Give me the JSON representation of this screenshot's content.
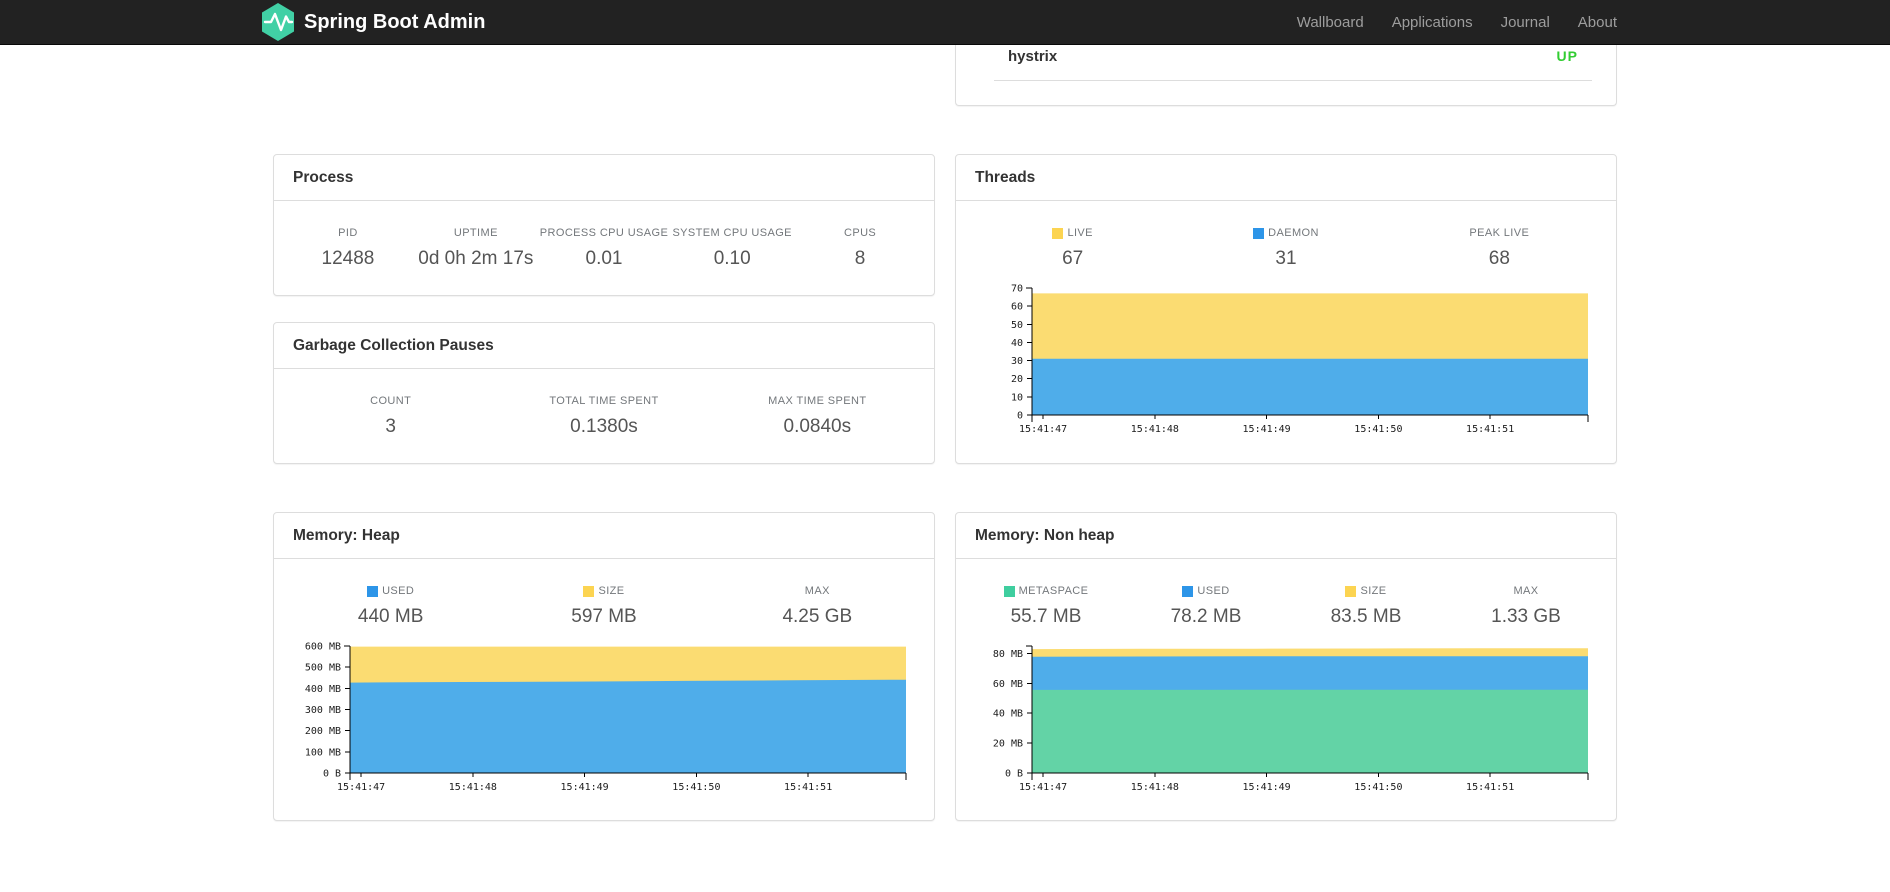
{
  "navbar": {
    "brand": "Spring Boot Admin",
    "logo_color": "#41d0a5",
    "links": [
      {
        "label": "Wallboard"
      },
      {
        "label": "Applications"
      },
      {
        "label": "Journal"
      },
      {
        "label": "About"
      }
    ]
  },
  "application_panel": {
    "name": "hystrix",
    "status": "UP",
    "status_color": "#32cd32"
  },
  "process": {
    "title": "Process",
    "stats": [
      {
        "label": "PID",
        "value": "12488"
      },
      {
        "label": "UPTIME",
        "value": "0d 0h 2m 17s"
      },
      {
        "label": "PROCESS CPU USAGE",
        "value": "0.01"
      },
      {
        "label": "SYSTEM CPU USAGE",
        "value": "0.10"
      },
      {
        "label": "CPUS",
        "value": "8"
      }
    ]
  },
  "gc": {
    "title": "Garbage Collection Pauses",
    "stats": [
      {
        "label": "COUNT",
        "value": "3"
      },
      {
        "label": "TOTAL TIME SPENT",
        "value": "0.1380s"
      },
      {
        "label": "MAX TIME SPENT",
        "value": "0.0840s"
      }
    ]
  },
  "threads": {
    "title": "Threads",
    "stats": [
      {
        "label": "LIVE",
        "value": "67",
        "swatch": "#fcd451"
      },
      {
        "label": "DAEMON",
        "value": "31",
        "swatch": "#2d95e8"
      },
      {
        "label": "PEAK LIVE",
        "value": "68"
      }
    ]
  },
  "heap": {
    "title": "Memory: Heap",
    "stats": [
      {
        "label": "USED",
        "value": "440 MB",
        "swatch": "#2d95e8"
      },
      {
        "label": "SIZE",
        "value": "597 MB",
        "swatch": "#fcd451"
      },
      {
        "label": "MAX",
        "value": "4.25 GB"
      }
    ]
  },
  "nonheap": {
    "title": "Memory: Non heap",
    "stats": [
      {
        "label": "METASPACE",
        "value": "55.7 MB",
        "swatch": "#3fce9f"
      },
      {
        "label": "USED",
        "value": "78.2 MB",
        "swatch": "#2d95e8"
      },
      {
        "label": "SIZE",
        "value": "83.5 MB",
        "swatch": "#fcd451"
      },
      {
        "label": "MAX",
        "value": "1.33 GB"
      }
    ]
  },
  "chart_data": [
    {
      "id": "threads",
      "type": "area",
      "title": "Threads",
      "render": "overlay",
      "x_ticks": [
        "15:41:47",
        "15:41:48",
        "15:41:49",
        "15:41:50",
        "15:41:51"
      ],
      "ylim": [
        0,
        70
      ],
      "y_ticks": [
        {
          "value": 0,
          "label": "0"
        },
        {
          "value": 10,
          "label": "10"
        },
        {
          "value": 20,
          "label": "20"
        },
        {
          "value": 30,
          "label": "30"
        },
        {
          "value": 40,
          "label": "40"
        },
        {
          "value": 50,
          "label": "50"
        },
        {
          "value": 60,
          "label": "60"
        },
        {
          "value": 70,
          "label": "70"
        }
      ],
      "series": [
        {
          "name": "LIVE",
          "color": "#fbdc72",
          "values": [
            67,
            67,
            67,
            67,
            67,
            67
          ]
        },
        {
          "name": "DAEMON",
          "color": "#4fadea",
          "values": [
            31,
            31,
            31,
            31,
            31,
            31
          ]
        }
      ]
    },
    {
      "id": "heap",
      "type": "area",
      "title": "Memory: Heap",
      "render": "overlay",
      "x_ticks": [
        "15:41:47",
        "15:41:48",
        "15:41:49",
        "15:41:50",
        "15:41:51"
      ],
      "ylim": [
        0,
        600
      ],
      "y_ticks": [
        {
          "value": 0,
          "label": "0 B"
        },
        {
          "value": 100,
          "label": "100 MB"
        },
        {
          "value": 200,
          "label": "200 MB"
        },
        {
          "value": 300,
          "label": "300 MB"
        },
        {
          "value": 400,
          "label": "400 MB"
        },
        {
          "value": 500,
          "label": "500 MB"
        },
        {
          "value": 600,
          "label": "600 MB"
        }
      ],
      "series": [
        {
          "name": "SIZE",
          "color": "#fbdc72",
          "values": [
            597,
            597,
            597,
            597,
            597,
            597
          ]
        },
        {
          "name": "USED",
          "color": "#4fadea",
          "values": [
            427,
            430,
            432,
            435,
            438,
            441
          ]
        }
      ]
    },
    {
      "id": "nonheap",
      "type": "area",
      "title": "Memory: Non heap",
      "render": "overlay",
      "x_ticks": [
        "15:41:47",
        "15:41:48",
        "15:41:49",
        "15:41:50",
        "15:41:51"
      ],
      "ylim": [
        0,
        85
      ],
      "y_ticks": [
        {
          "value": 0,
          "label": "0 B"
        },
        {
          "value": 20,
          "label": "20 MB"
        },
        {
          "value": 40,
          "label": "40 MB"
        },
        {
          "value": 60,
          "label": "60 MB"
        },
        {
          "value": 80,
          "label": "80 MB"
        }
      ],
      "series": [
        {
          "name": "SIZE",
          "color": "#fbdc72",
          "values": [
            82.9,
            83.1,
            83.2,
            83.3,
            83.5,
            83.5
          ]
        },
        {
          "name": "USED",
          "color": "#4fadea",
          "values": [
            77.8,
            78,
            78.2,
            78.2,
            78.2,
            78.2
          ]
        },
        {
          "name": "METASPACE",
          "color": "#63d3a6",
          "values": [
            55.6,
            55.6,
            55.7,
            55.7,
            55.7,
            55.7
          ]
        }
      ]
    }
  ]
}
